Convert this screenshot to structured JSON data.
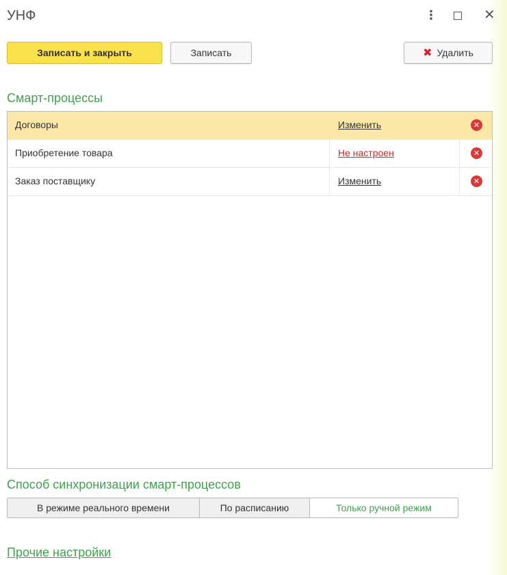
{
  "window": {
    "title": "УНФ",
    "more_glyph": "⋮",
    "close_glyph": "✕"
  },
  "toolbar": {
    "save_close_label": "Записать и закрыть",
    "save_label": "Записать",
    "delete_label": "Удалить"
  },
  "smart_processes": {
    "heading": "Смарт-процессы",
    "rows": [
      {
        "name": "Договоры",
        "action": "Изменить",
        "status": "normal",
        "selected": true
      },
      {
        "name": "Приобретение товара",
        "action": "Не настроен",
        "status": "warning",
        "selected": false
      },
      {
        "name": "Заказ поставщику",
        "action": "Изменить",
        "status": "normal",
        "selected": false
      }
    ]
  },
  "sync": {
    "heading": "Способ синхронизации смарт-процессов",
    "options": [
      {
        "label": "В режиме реального времени",
        "selected": false
      },
      {
        "label": "По расписанию",
        "selected": false
      },
      {
        "label": "Только ручной режим",
        "selected": true
      }
    ]
  },
  "other_settings": {
    "label": "Прочие настройки"
  },
  "colors": {
    "accent": "#3f9f4f",
    "primary_button": "#fbe14b",
    "selected_row": "#fbe8a7",
    "danger": "#d83a3a"
  },
  "icons": {
    "delete": "x-icon",
    "row_delete": "remove-circle-icon"
  }
}
